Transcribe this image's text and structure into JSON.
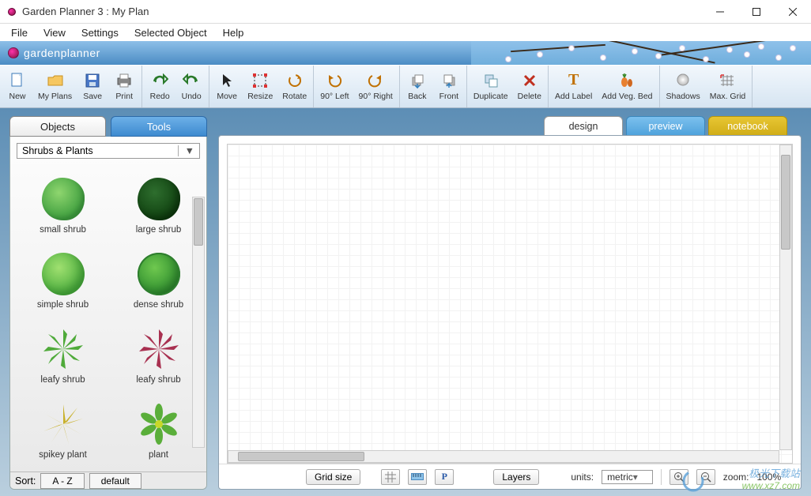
{
  "window": {
    "title": "Garden Planner 3 : My  Plan"
  },
  "menu": [
    "File",
    "View",
    "Settings",
    "Selected Object",
    "Help"
  ],
  "brand": "gardenplanner",
  "toolbar": {
    "new": "New",
    "myplans": "My Plans",
    "save": "Save",
    "print": "Print",
    "redo": "Redo",
    "undo": "Undo",
    "move": "Move",
    "resize": "Resize",
    "rotate": "Rotate",
    "rleft": "90° Left",
    "rright": "90° Right",
    "back": "Back",
    "front": "Front",
    "duplicate": "Duplicate",
    "delete": "Delete",
    "addlabel": "Add Label",
    "addveg": "Add Veg. Bed",
    "shadows": "Shadows",
    "maxgrid": "Max. Grid"
  },
  "side_tabs": {
    "objects": "Objects",
    "tools": "Tools"
  },
  "category": "Shrubs & Plants",
  "objects": [
    {
      "label": "small shrub"
    },
    {
      "label": "large shrub"
    },
    {
      "label": "simple shrub"
    },
    {
      "label": "dense shrub"
    },
    {
      "label": "leafy shrub"
    },
    {
      "label": "leafy shrub"
    },
    {
      "label": "spikey plant"
    },
    {
      "label": "plant"
    }
  ],
  "sort": {
    "label": "Sort:",
    "az": "A - Z",
    "default": "default"
  },
  "view_tabs": {
    "design": "design",
    "preview": "preview",
    "notebook": "notebook"
  },
  "bottom": {
    "gridsize": "Grid size",
    "layers": "Layers",
    "units_label": "units:",
    "units_value": "metric",
    "zoom_label": "zoom:",
    "zoom_value": "100%"
  },
  "watermark": {
    "line1": "极光下载站",
    "line2": "www.xz7.com"
  }
}
